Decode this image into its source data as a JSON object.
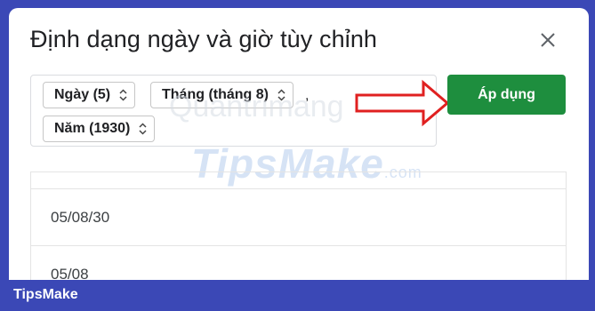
{
  "dialog": {
    "title": "Định dạng ngày và giờ tùy chỉnh",
    "close_icon": "close-icon"
  },
  "format": {
    "chips": [
      {
        "label": "Ngày (5)"
      },
      {
        "label": "Tháng (tháng 8)"
      },
      {
        "label": "Năm (1930)"
      }
    ],
    "separator": ","
  },
  "actions": {
    "apply_label": "Áp dụng"
  },
  "watermark": {
    "top": "Quantrimang",
    "main": "TipsMake",
    "suffix": ".com"
  },
  "list": {
    "items": [
      "05/08/30",
      "05/08"
    ]
  },
  "footer": {
    "brand": "TipsMake"
  },
  "colors": {
    "apply": "#1e8e3e",
    "arrow": "#e02020",
    "frame": "#3b48b6"
  }
}
